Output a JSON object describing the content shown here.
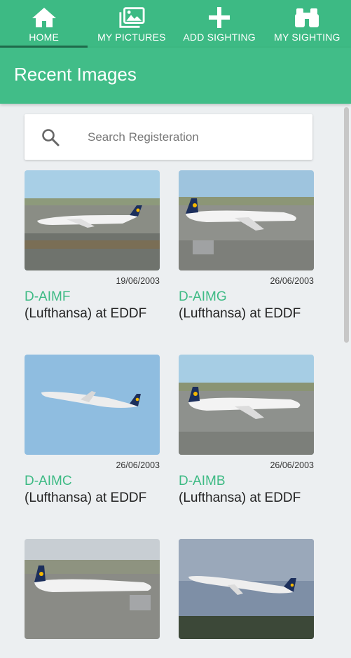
{
  "nav": {
    "items": [
      {
        "label": "HOME",
        "icon": "home-icon"
      },
      {
        "label": "MY PICTURES",
        "icon": "pictures-icon"
      },
      {
        "label": "ADD SIGHTING",
        "icon": "plus-icon"
      },
      {
        "label": "MY SIGHTING",
        "icon": "binoculars-icon"
      }
    ],
    "active": "HOME"
  },
  "page": {
    "title": "Recent Images"
  },
  "search": {
    "placeholder": "Search Registeration",
    "value": ""
  },
  "images": [
    {
      "registration": "D-AIMF",
      "description": "(Lufthansa) at EDDF",
      "date": "19/06/2003"
    },
    {
      "registration": "D-AIMG",
      "description": "(Lufthansa) at EDDF",
      "date": "26/06/2003"
    },
    {
      "registration": "D-AIMC",
      "description": "(Lufthansa) at EDDF",
      "date": "26/06/2003"
    },
    {
      "registration": "D-AIMB",
      "description": "(Lufthansa) at EDDF",
      "date": "26/06/2003"
    },
    {
      "registration": "",
      "description": "",
      "date": ""
    },
    {
      "registration": "",
      "description": "",
      "date": ""
    }
  ],
  "colors": {
    "brand": "#3dba84",
    "active_indicator": "#1f6b4b",
    "background": "#eceff1",
    "registration_text": "#3dba84"
  }
}
